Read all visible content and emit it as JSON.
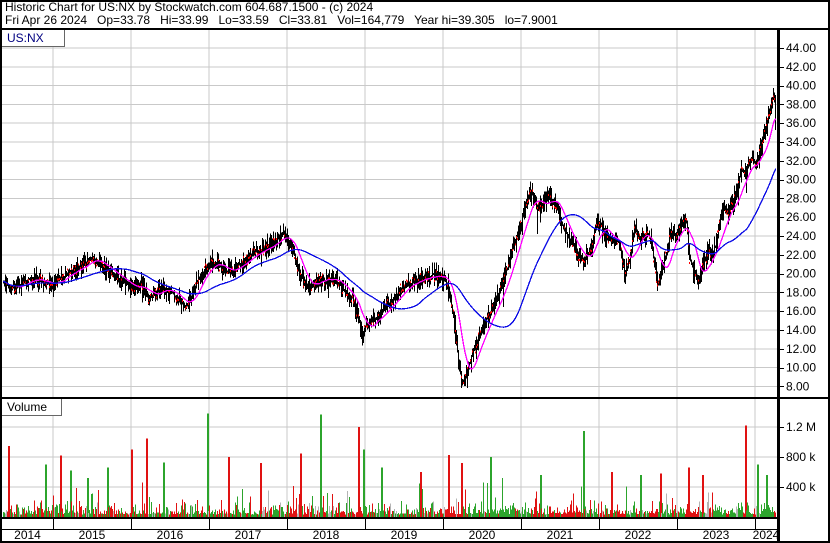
{
  "header": {
    "title": "Historic Chart for US:NX by Stockwatch.com 604.687.1500 - (c) 2024",
    "quote": "Fri Apr 26 2024   Op=33.78   Hi=33.99   Lo=33.59   Cl=33.81   Vol=164,779   Year hi=39.305   lo=7.9001",
    "fields": {
      "date": "Fri Apr 26 2024",
      "open": "33.78",
      "high": "33.99",
      "low": "33.59",
      "close": "33.81",
      "volume": "164,779",
      "year_high": "39.305",
      "year_low": "7.9001"
    }
  },
  "price_panel": {
    "symbol": "US:NX"
  },
  "volume_panel": {
    "label": "Volume"
  },
  "axes": {
    "price_labels": [
      "44.00",
      "42.00",
      "40.00",
      "38.00",
      "36.00",
      "34.00",
      "32.00",
      "30.00",
      "28.00",
      "26.00",
      "24.00",
      "22.00",
      "20.00",
      "18.00",
      "16.00",
      "14.00",
      "12.00",
      "10.00",
      "8.00"
    ],
    "volume_labels": [
      "1.2 M",
      "800 k",
      "400 k"
    ],
    "volume_values": [
      1200000,
      800000,
      400000
    ],
    "years": [
      "2014",
      "2015",
      "2016",
      "2017",
      "2018",
      "2019",
      "2020",
      "2021",
      "2022",
      "2023",
      "2024"
    ]
  },
  "colors": {
    "bg": "#ffffff",
    "grid": "#c9c9c9",
    "bar": "#000000",
    "bar_accent": "#ff0000",
    "symbol_text": "#000080",
    "border": "#000000"
  },
  "chart_data": [
    {
      "type": "line",
      "name": "US:NX price history (daily OHLC bars)",
      "x_unit": "year (decimal)",
      "y_unit": "USD",
      "xlim": [
        2014.32,
        2024.28
      ],
      "ylim": [
        6.8,
        45.9
      ],
      "grid_step": 2.0,
      "legend_position": "none",
      "last_bar": {
        "open": 33.78,
        "high": 33.99,
        "low": 33.59,
        "close": 33.81,
        "volume": 164779
      },
      "period_high": 39.305,
      "period_low": 7.9001,
      "moving_averages": [
        {
          "name": "fast-ma",
          "color": "#ff00ff",
          "window": 15
        },
        {
          "name": "slow-ma",
          "color": "#0a0ae6",
          "window": 60
        }
      ],
      "points": [
        [
          2014.32,
          19.2
        ],
        [
          2014.47,
          18.4
        ],
        [
          2014.6,
          18.9
        ],
        [
          2014.73,
          19.5
        ],
        [
          2014.86,
          19.1
        ],
        [
          2015.0,
          18.8
        ],
        [
          2015.15,
          19.9
        ],
        [
          2015.32,
          20.7
        ],
        [
          2015.51,
          21.6
        ],
        [
          2015.67,
          20.5
        ],
        [
          2015.83,
          19.6
        ],
        [
          2016.0,
          18.5
        ],
        [
          2016.13,
          18.8
        ],
        [
          2016.22,
          17.3
        ],
        [
          2016.35,
          18.3
        ],
        [
          2016.5,
          18.1
        ],
        [
          2016.63,
          17.0
        ],
        [
          2016.72,
          16.6
        ],
        [
          2016.83,
          19.0
        ],
        [
          2016.97,
          20.7
        ],
        [
          2017.06,
          21.4
        ],
        [
          2017.17,
          20.4
        ],
        [
          2017.27,
          20.3
        ],
        [
          2017.4,
          21.1
        ],
        [
          2017.55,
          21.9
        ],
        [
          2017.71,
          22.8
        ],
        [
          2017.86,
          23.5
        ],
        [
          2017.96,
          24.3
        ],
        [
          2018.06,
          22.5
        ],
        [
          2018.17,
          19.6
        ],
        [
          2018.26,
          18.5
        ],
        [
          2018.37,
          19.3
        ],
        [
          2018.5,
          19.4
        ],
        [
          2018.63,
          19.2
        ],
        [
          2018.74,
          18.2
        ],
        [
          2018.85,
          17.0
        ],
        [
          2018.92,
          15.0
        ],
        [
          2018.96,
          13.0
        ],
        [
          2019.01,
          14.7
        ],
        [
          2019.12,
          15.2
        ],
        [
          2019.24,
          16.2
        ],
        [
          2019.37,
          17.4
        ],
        [
          2019.5,
          18.7
        ],
        [
          2019.62,
          19.1
        ],
        [
          2019.73,
          19.6
        ],
        [
          2019.85,
          19.7
        ],
        [
          2019.96,
          19.8
        ],
        [
          2020.05,
          18.8
        ],
        [
          2020.13,
          15.5
        ],
        [
          2020.19,
          11.0
        ],
        [
          2020.24,
          8.4
        ],
        [
          2020.31,
          9.9
        ],
        [
          2020.38,
          11.6
        ],
        [
          2020.47,
          13.6
        ],
        [
          2020.58,
          15.5
        ],
        [
          2020.68,
          17.3
        ],
        [
          2020.78,
          19.6
        ],
        [
          2020.87,
          22.0
        ],
        [
          2020.95,
          24.2
        ],
        [
          2021.03,
          26.3
        ],
        [
          2021.12,
          28.7
        ],
        [
          2021.19,
          27.2
        ],
        [
          2021.26,
          27.0
        ],
        [
          2021.35,
          28.3
        ],
        [
          2021.44,
          27.2
        ],
        [
          2021.53,
          25.0
        ],
        [
          2021.63,
          23.4
        ],
        [
          2021.73,
          22.0
        ],
        [
          2021.82,
          21.4
        ],
        [
          2021.9,
          23.0
        ],
        [
          2021.97,
          25.6
        ],
        [
          2022.06,
          24.3
        ],
        [
          2022.15,
          23.4
        ],
        [
          2022.23,
          23.6
        ],
        [
          2022.28,
          22.4
        ],
        [
          2022.33,
          20.0
        ],
        [
          2022.4,
          22.0
        ],
        [
          2022.45,
          24.7
        ],
        [
          2022.51,
          23.9
        ],
        [
          2022.58,
          23.7
        ],
        [
          2022.63,
          24.2
        ],
        [
          2022.68,
          22.7
        ],
        [
          2022.74,
          18.9
        ],
        [
          2022.79,
          20.0
        ],
        [
          2022.86,
          22.2
        ],
        [
          2022.92,
          24.3
        ],
        [
          2022.99,
          24.0
        ],
        [
          2023.05,
          25.1
        ],
        [
          2023.12,
          25.6
        ],
        [
          2023.15,
          21.6
        ],
        [
          2023.21,
          20.1
        ],
        [
          2023.27,
          19.2
        ],
        [
          2023.33,
          21.0
        ],
        [
          2023.4,
          22.4
        ],
        [
          2023.45,
          22.1
        ],
        [
          2023.5,
          23.3
        ],
        [
          2023.55,
          26.2
        ],
        [
          2023.6,
          27.2
        ],
        [
          2023.65,
          26.5
        ],
        [
          2023.72,
          27.8
        ],
        [
          2023.77,
          29.3
        ],
        [
          2023.82,
          30.9
        ],
        [
          2023.87,
          30.4
        ],
        [
          2023.92,
          31.9
        ],
        [
          2023.97,
          32.3
        ],
        [
          2024.01,
          31.4
        ],
        [
          2024.06,
          33.2
        ],
        [
          2024.11,
          34.8
        ],
        [
          2024.16,
          36.4
        ],
        [
          2024.2,
          37.8
        ],
        [
          2024.24,
          39.1
        ],
        [
          2024.26,
          35.5
        ],
        [
          2024.28,
          33.8
        ]
      ]
    },
    {
      "type": "bar",
      "name": "Volume",
      "ylim": [
        0,
        1560000
      ],
      "gridlines": [
        400000,
        800000,
        1200000
      ],
      "up_color": "#2ca42c",
      "down_color": "#e01212",
      "neutral_color": "#b4b4b4",
      "spikes": [
        [
          2014.35,
          600000,
          "r"
        ],
        [
          2014.42,
          950000,
          "r"
        ],
        [
          2014.9,
          700000,
          "g"
        ],
        [
          2015.09,
          820000,
          "r"
        ],
        [
          2015.22,
          620000,
          "g"
        ],
        [
          2015.44,
          520000,
          "g"
        ],
        [
          2015.69,
          660000,
          "g"
        ],
        [
          2016.0,
          900000,
          "r"
        ],
        [
          2016.19,
          1050000,
          "r"
        ],
        [
          2016.41,
          730000,
          "g"
        ],
        [
          2016.97,
          1380000,
          "g"
        ],
        [
          2017.24,
          800000,
          "r"
        ],
        [
          2017.65,
          720000,
          "r"
        ],
        [
          2018.17,
          850000,
          "r"
        ],
        [
          2018.42,
          1370000,
          "g"
        ],
        [
          2018.91,
          1200000,
          "r"
        ],
        [
          2018.97,
          900000,
          "g"
        ],
        [
          2019.21,
          660000,
          "g"
        ],
        [
          2019.71,
          600000,
          "r"
        ],
        [
          2020.06,
          830000,
          "r"
        ],
        [
          2020.23,
          720000,
          "r"
        ],
        [
          2020.6,
          800000,
          "g"
        ],
        [
          2021.24,
          560000,
          "g"
        ],
        [
          2021.79,
          1150000,
          "g"
        ],
        [
          2022.16,
          600000,
          "r"
        ],
        [
          2022.53,
          560000,
          "g"
        ],
        [
          2022.78,
          580000,
          "r"
        ],
        [
          2023.14,
          660000,
          "r"
        ],
        [
          2023.32,
          560000,
          "r"
        ],
        [
          2023.87,
          1220000,
          "r"
        ],
        [
          2024.03,
          700000,
          "g"
        ],
        [
          2024.14,
          560000,
          "g"
        ]
      ]
    }
  ]
}
